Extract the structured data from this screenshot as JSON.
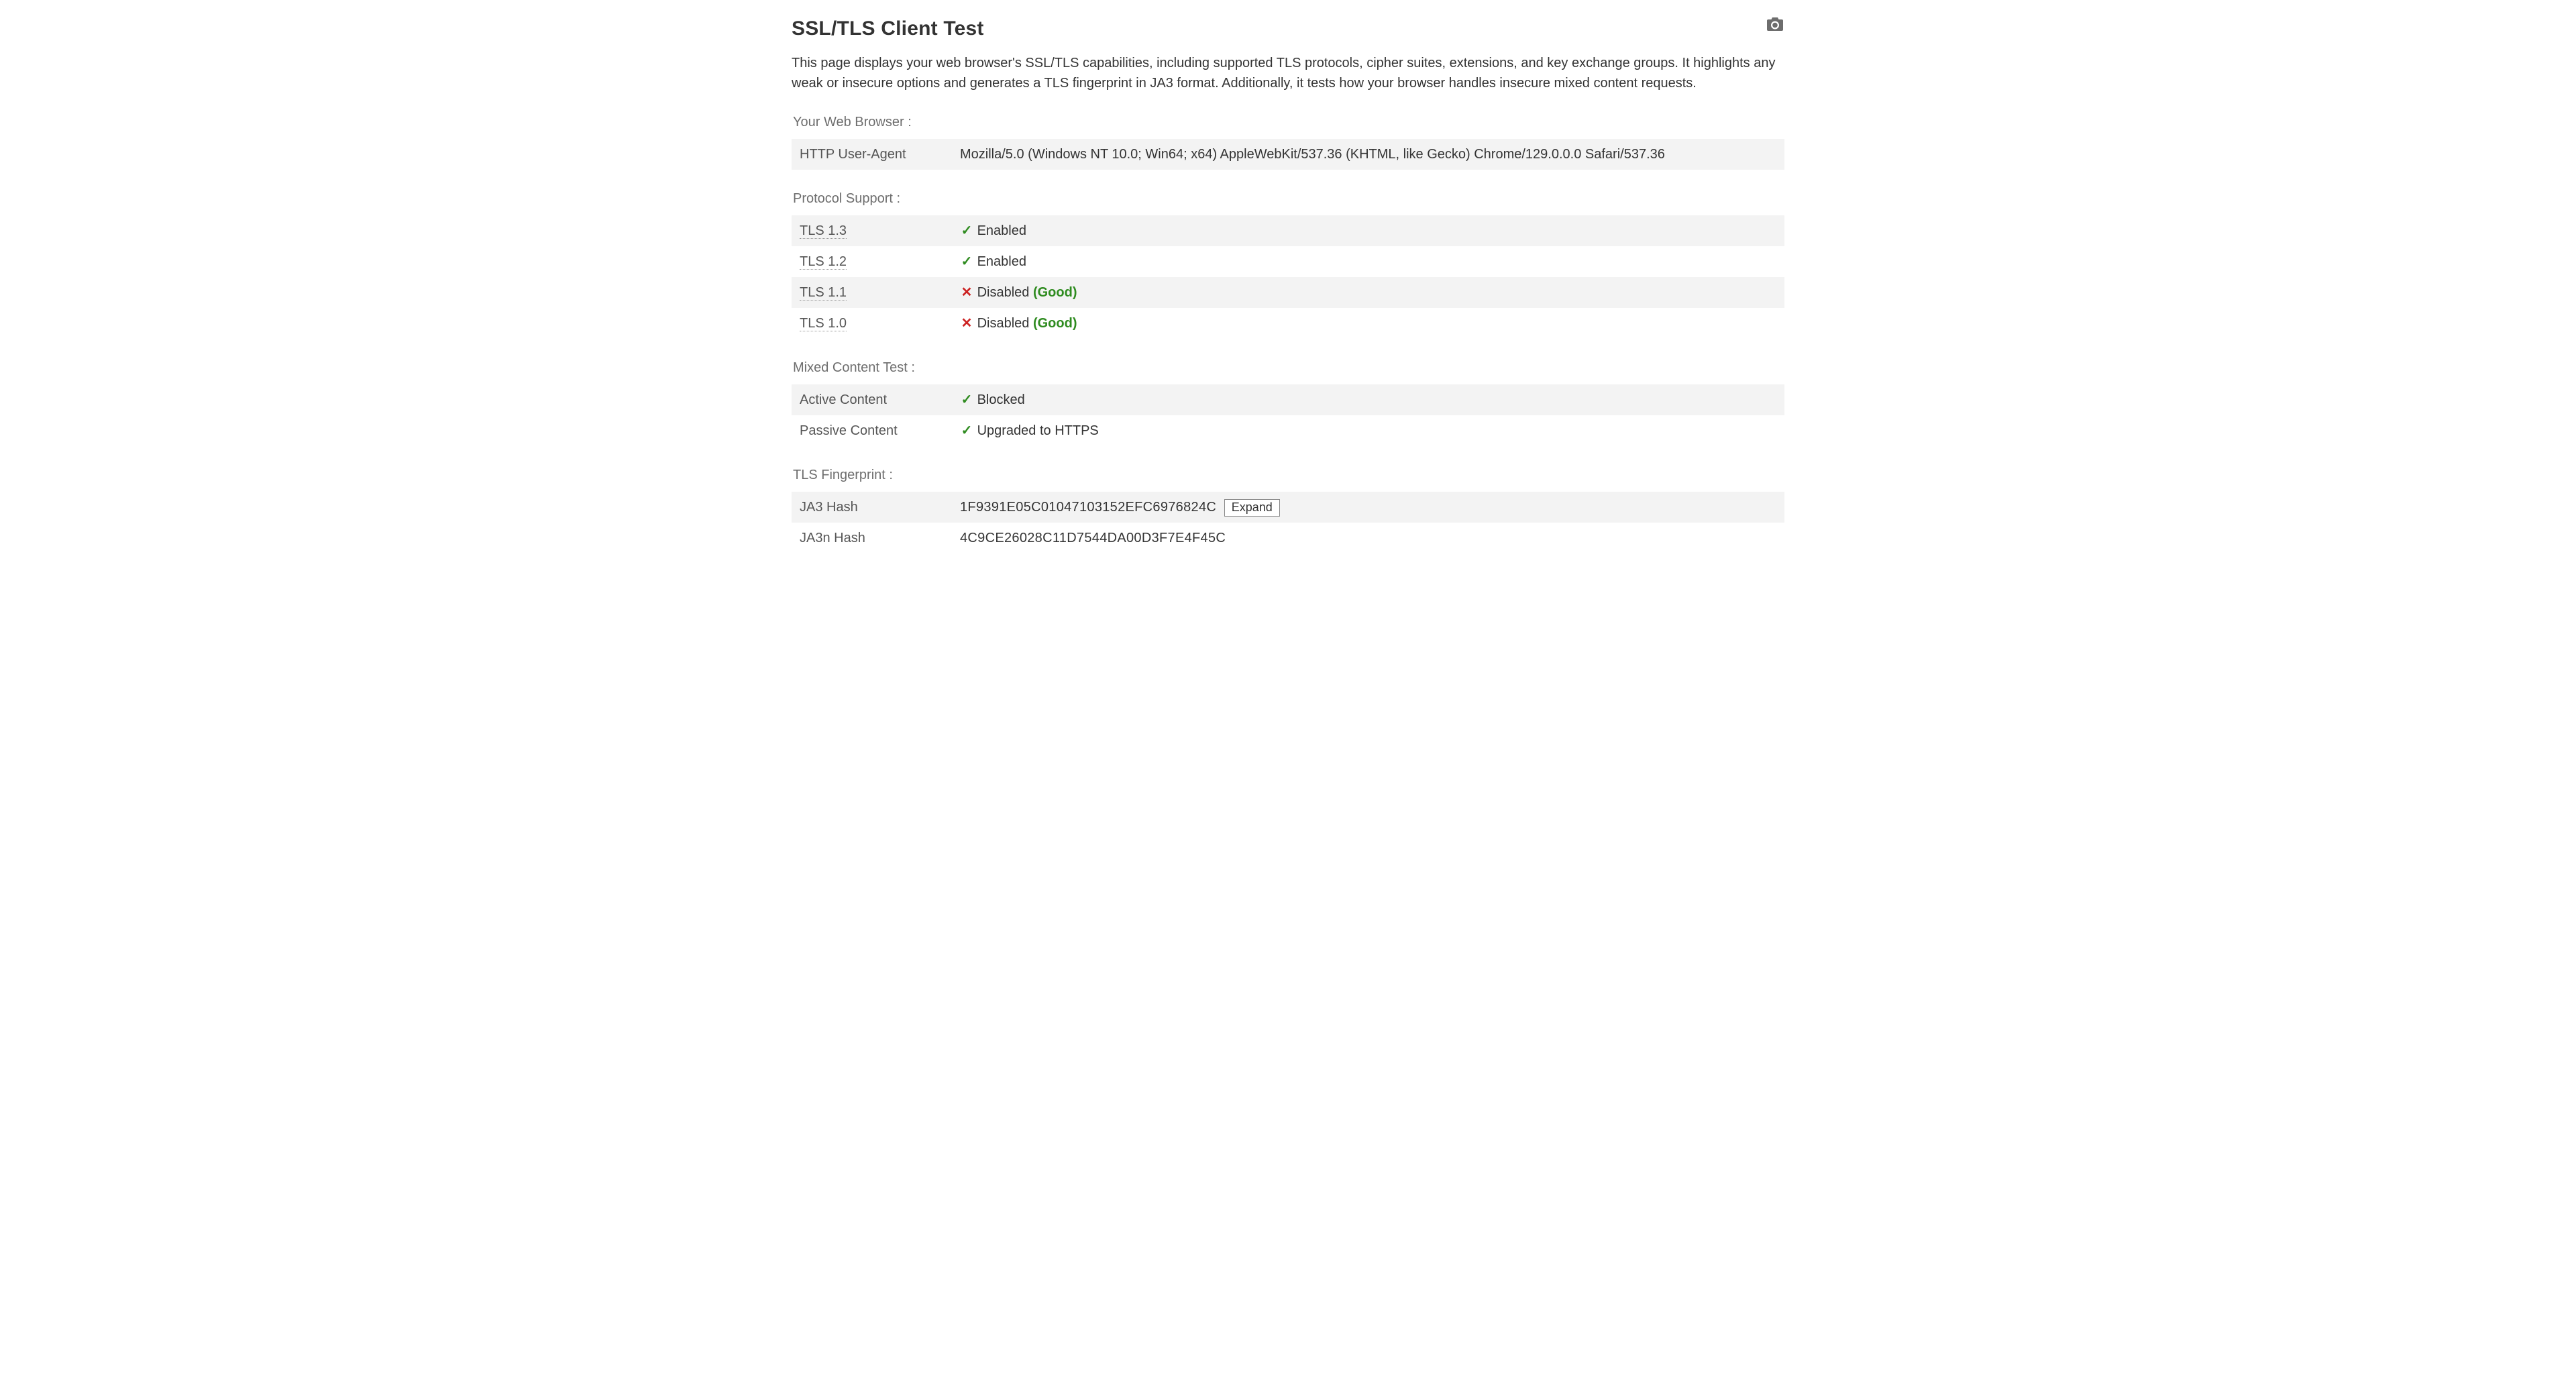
{
  "header": {
    "title": "SSL/TLS Client Test",
    "intro": "This page displays your web browser's SSL/TLS capabilities, including supported TLS protocols, cipher suites, extensions, and key exchange groups. It highlights any weak or insecure options and generates a TLS fingerprint in JA3 format. Additionally, it tests how your browser handles insecure mixed content requests.",
    "screenshot_tooltip": "Screenshot"
  },
  "labels": {
    "good": "(Good)",
    "expand": "Expand"
  },
  "browser_section": {
    "title": "Your Web Browser :",
    "rows": [
      {
        "label": "HTTP User-Agent",
        "value": "Mozilla/5.0 (Windows NT 10.0; Win64; x64) AppleWebKit/537.36 (KHTML, like Gecko) Chrome/129.0.0.0 Safari/537.36"
      }
    ]
  },
  "protocol_section": {
    "title": "Protocol Support :",
    "rows": [
      {
        "label": "TLS 1.3",
        "status": "enabled",
        "text": "Enabled"
      },
      {
        "label": "TLS 1.2",
        "status": "enabled",
        "text": "Enabled"
      },
      {
        "label": "TLS 1.1",
        "status": "disabled",
        "text": "Disabled",
        "good": true
      },
      {
        "label": "TLS 1.0",
        "status": "disabled",
        "text": "Disabled",
        "good": true
      }
    ]
  },
  "mixed_section": {
    "title": "Mixed Content Test :",
    "rows": [
      {
        "label": "Active Content",
        "status": "ok",
        "text": "Blocked"
      },
      {
        "label": "Passive Content",
        "status": "ok",
        "text": "Upgraded to HTTPS"
      }
    ]
  },
  "fingerprint_section": {
    "title": "TLS Fingerprint :",
    "rows": [
      {
        "label": "JA3 Hash",
        "value": "1F9391E05C01047103152EFC6976824C",
        "expand": true
      },
      {
        "label": "JA3n Hash",
        "value": "4C9CE26028C11D7544DA00D3F7E4F45C"
      }
    ]
  }
}
